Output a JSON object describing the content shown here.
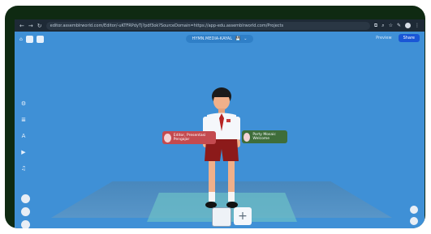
{
  "browser": {
    "url": "editor.assemblrworld.com/Editor/-uKTFRPdyTj?pdf3ok?SourceDomain=https://app-edu.assemblrworld.com/Projects"
  },
  "editor": {
    "project_title": "HYMN.MEDIA-KAYAL"
  },
  "tags": {
    "left": "Editor, Presentasi Pengajar",
    "right": "Party Mosaic Welcome"
  },
  "bottom": {
    "add_label": "+"
  },
  "top_right": {
    "preview_label": "Preview",
    "share_label": "Share"
  }
}
